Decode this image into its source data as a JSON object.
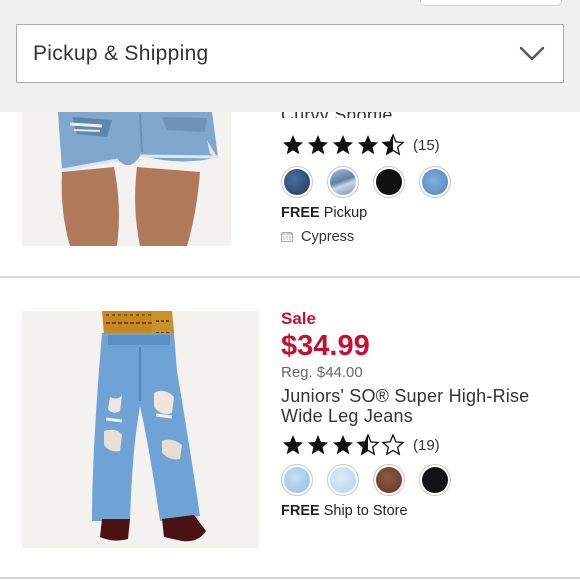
{
  "filter": {
    "dropdown_label": "Pickup & Shipping"
  },
  "products": [
    {
      "title_partial": "Curvy Shortie",
      "rating": 4.5,
      "rating_count": "(15)",
      "swatches": [
        {
          "name": "dark-wash-ripped",
          "color": "#2b4a73"
        },
        {
          "name": "light-wash-ripped",
          "color": "#8fb0cf"
        },
        {
          "name": "black",
          "color": "#111111"
        },
        {
          "name": "medium-wash",
          "color": "#5d94c8"
        }
      ],
      "fulfillment_bold": "FREE",
      "fulfillment_text": "Pickup",
      "store": "Cypress"
    },
    {
      "sale_label": "Sale",
      "sale_price": "$34.99",
      "regular_price": "Reg. $44.00",
      "title_line1": "Juniors' SO® Super High-Rise",
      "title_line2": "Wide Leg Jeans",
      "rating": 3.5,
      "rating_count": "(19)",
      "swatches": [
        {
          "name": "light-wash",
          "color": "#a9cbea"
        },
        {
          "name": "pale-blue",
          "color": "#c6def3"
        },
        {
          "name": "brown",
          "color": "#7a4a38"
        },
        {
          "name": "black",
          "color": "#121317"
        }
      ],
      "fulfillment_bold": "FREE",
      "fulfillment_text": "Ship to Store"
    }
  ],
  "colors": {
    "sale_red": "#c8102e",
    "star": "#111111",
    "header_bg": "#f0f0f0"
  }
}
